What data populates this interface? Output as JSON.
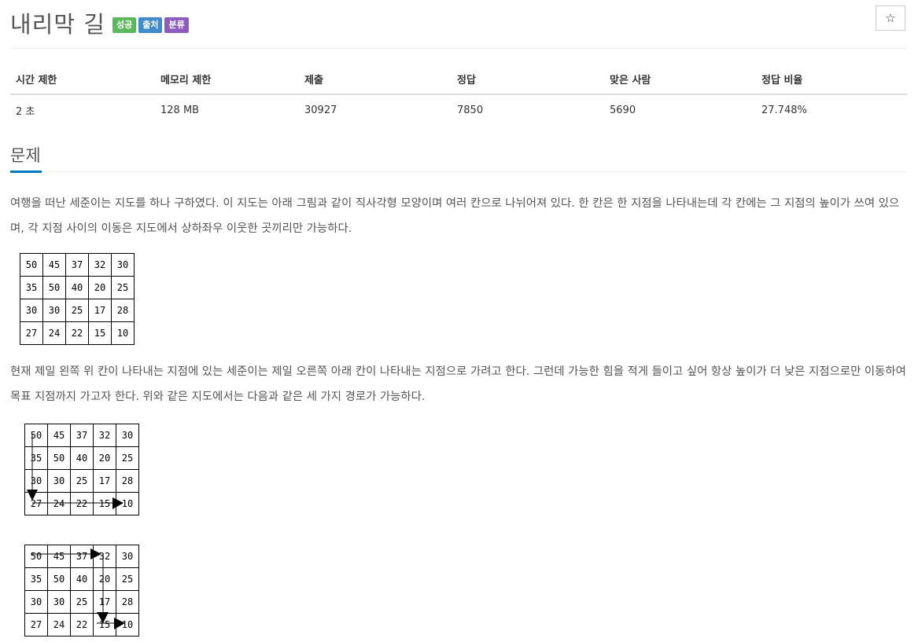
{
  "problem": {
    "title": "내리막 길",
    "badges": [
      {
        "label": "성공",
        "color": "#5cb85c"
      },
      {
        "label": "출처",
        "color": "#428bca"
      },
      {
        "label": "분류",
        "color": "#8e5cbf"
      }
    ],
    "star_icon": "☆"
  },
  "info_table": {
    "headers": [
      "시간 제한",
      "메모리 제한",
      "제출",
      "정답",
      "맞은 사람",
      "정답 비율"
    ],
    "values": [
      "2 초",
      "128 MB",
      "30927",
      "7850",
      "5690",
      "27.748%"
    ]
  },
  "section": {
    "title": "문제",
    "paragraph1": "여행을 떠난 세준이는 지도를 하나 구하였다. 이 지도는 아래 그림과 같이 직사각형 모양이며 여러 칸으로 나뉘어져 있다. 한 칸은 한 지점을 나타내는데 각 칸에는 그 지점의 높이가 쓰여 있으며, 각 지점 사이의 이동은 지도에서 상하좌우 이웃한 곳끼리만 가능하다.",
    "paragraph2": "현재 제일 왼쪽 위 칸이 나타내는 지점에 있는 세준이는 제일 오른쪽 아래 칸이 나타내는 지점으로 가려고 한다. 그런데 가능한 힘을 적게 들이고 싶어 항상 높이가 더 낮은 지점으로만 이동하여 목표 지점까지 가고자 한다. 위와 같은 지도에서는 다음과 같은 세 가지 경로가 가능하다."
  },
  "map_grid": [
    [
      "50",
      "45",
      "37",
      "32",
      "30"
    ],
    [
      "35",
      "50",
      "40",
      "20",
      "25"
    ],
    [
      "30",
      "30",
      "25",
      "17",
      "28"
    ],
    [
      "27",
      "24",
      "22",
      "15",
      "10"
    ]
  ]
}
